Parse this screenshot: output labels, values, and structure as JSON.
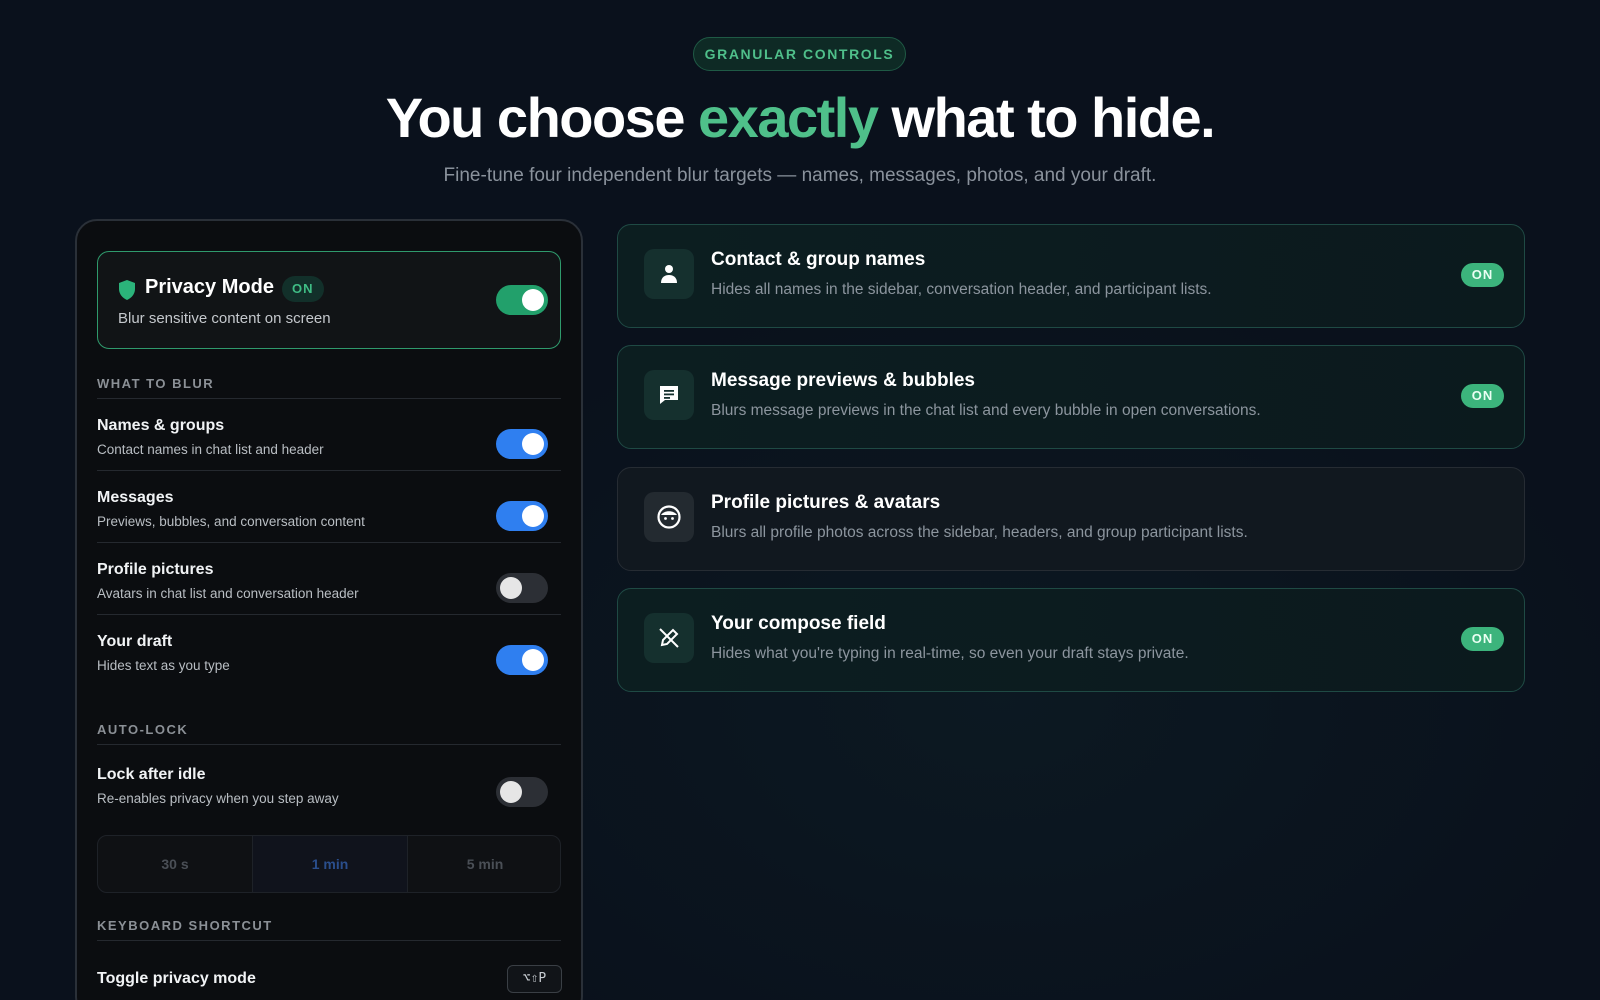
{
  "hero": {
    "eyebrow": "GRANULAR CONTROLS",
    "headline_pre": "You choose ",
    "headline_accent": "exactly",
    "headline_post": " what to hide.",
    "subhead": "Fine-tune four independent blur targets — names, messages, photos, and your draft."
  },
  "colors": {
    "accent_green": "#4fc08a",
    "toggle_blue": "#2f7ff0",
    "background": "#0a111c"
  },
  "panel": {
    "privacy_mode": {
      "title": "Privacy Mode",
      "badge": "ON",
      "subtitle": "Blur sensitive content on screen",
      "enabled": true
    },
    "what_to_blur": {
      "label": "WHAT TO BLUR",
      "items": [
        {
          "title": "Names & groups",
          "subtitle": "Contact names in chat list and header",
          "enabled": true
        },
        {
          "title": "Messages",
          "subtitle": "Previews, bubbles, and conversation content",
          "enabled": true
        },
        {
          "title": "Profile pictures",
          "subtitle": "Avatars in chat list and conversation header",
          "enabled": false
        },
        {
          "title": "Your draft",
          "subtitle": "Hides text as you type",
          "enabled": true
        }
      ]
    },
    "auto_lock": {
      "label": "AUTO-LOCK",
      "title": "Lock after idle",
      "subtitle": "Re-enables privacy when you step away",
      "enabled": false,
      "options": [
        "30 s",
        "1 min",
        "5 min"
      ],
      "selected": "1 min"
    },
    "shortcut": {
      "label": "KEYBOARD SHORTCUT",
      "title": "Toggle privacy mode",
      "keys": "⌥⇧P"
    }
  },
  "cards": [
    {
      "icon": "person-icon",
      "title": "Contact & group names",
      "desc": "Hides all names in the sidebar, conversation header, and participant lists.",
      "badge": "ON"
    },
    {
      "icon": "chat-bubble-icon",
      "title": "Message previews & bubbles",
      "desc": "Blurs message previews in the chat list and every bubble in open conversations.",
      "badge": "ON"
    },
    {
      "icon": "face-icon",
      "title": "Profile pictures & avatars",
      "desc": "Blurs all profile photos across the sidebar, headers, and group participant lists.",
      "badge": ""
    },
    {
      "icon": "pen-slash-icon",
      "title": "Your compose field",
      "desc": "Hides what you're typing in real-time, so even your draft stays private.",
      "badge": "ON"
    }
  ]
}
